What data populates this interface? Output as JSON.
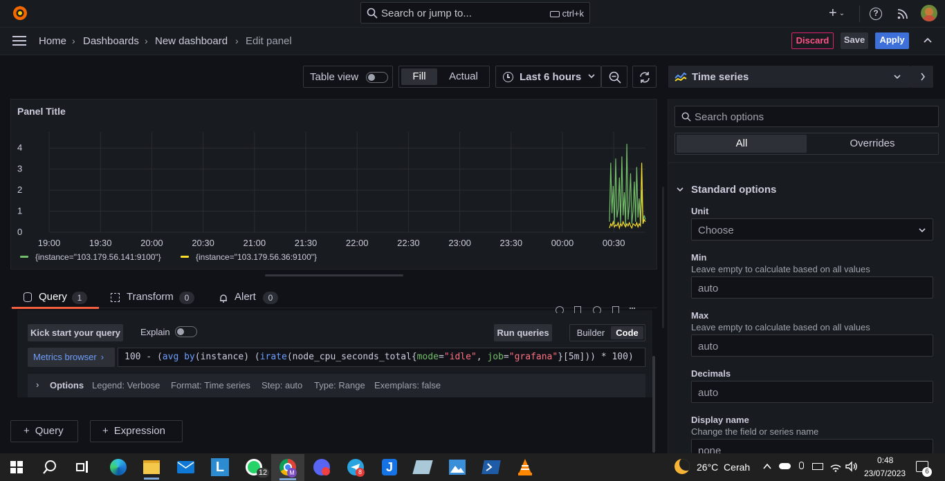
{
  "topbar": {
    "search_placeholder": "Search or jump to...",
    "search_shortcut": "ctrl+k"
  },
  "breadcrumb": [
    "Home",
    "Dashboards",
    "New dashboard",
    "Edit panel"
  ],
  "actions": {
    "discard": "Discard",
    "save": "Save",
    "apply": "Apply"
  },
  "toolbar": {
    "table_view": "Table view",
    "fill": "Fill",
    "actual": "Actual",
    "time_range": "Last 6 hours"
  },
  "visualization": {
    "name": "Time series"
  },
  "panel": {
    "title": "Panel Title"
  },
  "chart_data": {
    "type": "line",
    "y_ticks": [
      "0",
      "1",
      "2",
      "3",
      "4"
    ],
    "x_ticks": [
      "19:00",
      "19:30",
      "20:00",
      "20:30",
      "21:00",
      "21:30",
      "22:00",
      "22:30",
      "23:00",
      "23:30",
      "00:00",
      "00:30"
    ],
    "ylim": [
      0,
      4.5
    ],
    "grid": true,
    "legend_position": "bottom-left",
    "series": [
      {
        "name": "{instance=\"103.179.56.141:9100\"}",
        "color": "#73bf69",
        "values": [
          0.5,
          3.3,
          0.9,
          2.2,
          0.4,
          3.5,
          0.7,
          1.1,
          2.6,
          0.4,
          3.6,
          0.8,
          1.9,
          0.3,
          4.2,
          0.6,
          1.3,
          2.8,
          0.4,
          1.0,
          2.4,
          0.5,
          3.1,
          0.7,
          1.6,
          0.4,
          2.0,
          0.5,
          0.8,
          0.6
        ]
      },
      {
        "name": "{instance=\"103.179.56.36:9100\"}",
        "color": "#fade2a",
        "values": [
          0.2,
          0.4,
          0.3,
          0.5,
          0.25,
          0.35,
          0.3,
          0.45,
          0.2,
          0.4,
          0.3,
          0.5,
          0.35,
          0.25,
          0.4,
          0.3,
          0.45,
          0.3,
          0.2,
          0.4,
          0.35,
          0.3,
          0.45,
          0.25,
          0.4,
          0.3,
          3.3,
          0.4,
          0.6,
          0.5
        ]
      }
    ]
  },
  "tabs": [
    {
      "label": "Query",
      "count": "1"
    },
    {
      "label": "Transform",
      "count": "0"
    },
    {
      "label": "Alert",
      "count": "0"
    }
  ],
  "query": {
    "kick_start": "Kick start your query",
    "explain": "Explain",
    "run_queries": "Run queries",
    "builder": "Builder",
    "code": "Code",
    "metrics_browser": "Metrics browser",
    "expr_parts": [
      "100 - (",
      "avg",
      " ",
      "by",
      "(instance) (",
      "irate",
      "(node_cpu_seconds_total{",
      "mode",
      "=",
      "\"idle\"",
      ", ",
      "job",
      "=",
      "\"grafana\"",
      "}[5m])) * 100)"
    ],
    "options_label": "Options",
    "legend": "Legend: Verbose",
    "format": "Format: Time series",
    "step": "Step: auto",
    "qtype": "Type: Range",
    "exemplars": "Exemplars: false",
    "add_query": "Query",
    "add_expression": "Expression"
  },
  "options_pane": {
    "search_placeholder": "Search options",
    "tab_all": "All",
    "tab_overrides": "Overrides",
    "section": "Standard options",
    "unit_label": "Unit",
    "unit_value": "Choose",
    "min_label": "Min",
    "min_desc": "Leave empty to calculate based on all values",
    "min_value": "auto",
    "max_label": "Max",
    "max_desc": "Leave empty to calculate based on all values",
    "max_value": "auto",
    "decimals_label": "Decimals",
    "decimals_value": "auto",
    "display_name_label": "Display name",
    "display_name_desc": "Change the field or series name",
    "display_name_value": "none"
  },
  "taskbar": {
    "weather": "26°C  Cerah",
    "time": "0:48",
    "date": "23/07/2023",
    "whatsapp_badge": "12",
    "telegram_badge": "8",
    "notif_count": "6"
  }
}
